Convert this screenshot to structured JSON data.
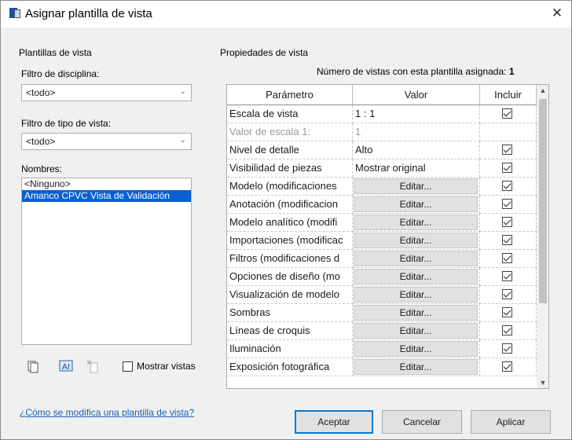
{
  "window": {
    "title": "Asignar plantilla de vista",
    "close_glyph": "✕"
  },
  "left": {
    "group_title": "Plantillas de vista",
    "discipline_filter": {
      "label": "Filtro de disciplina:",
      "value": "<todo>"
    },
    "viewtype_filter": {
      "label": "Filtro de tipo de vista:",
      "value": "<todo>"
    },
    "names_label": "Nombres:",
    "names": [
      "<Ninguno>",
      "Amanco CPVC Vista de Validación"
    ],
    "selected_index": 1,
    "show_views_label": "Mostrar vistas"
  },
  "right": {
    "group_title": "Propiedades de vista",
    "count_text": "Número de vistas con esta plantilla asignada:",
    "count_value": "1",
    "headers": {
      "param": "Parámetro",
      "value": "Valor",
      "include": "Incluir"
    },
    "rows": [
      {
        "param": "Escala de vista",
        "value": "1 : 1",
        "kind": "text",
        "include": true
      },
      {
        "param": "Valor de escala    1:",
        "value": "1",
        "kind": "gray",
        "include": null
      },
      {
        "param": "Nivel de detalle",
        "value": "Alto",
        "kind": "text",
        "include": true
      },
      {
        "param": "Visibilidad de piezas",
        "value": "Mostrar original",
        "kind": "text",
        "include": true
      },
      {
        "param": "Modelo (modificaciones",
        "value": "Editar...",
        "kind": "button",
        "include": true
      },
      {
        "param": "Anotación (modificacion",
        "value": "Editar...",
        "kind": "button",
        "include": true
      },
      {
        "param": "Modelo analítico (modifi",
        "value": "Editar...",
        "kind": "button",
        "include": true
      },
      {
        "param": "Importaciones (modificac",
        "value": "Editar...",
        "kind": "button",
        "include": true
      },
      {
        "param": "Filtros (modificaciones d",
        "value": "Editar...",
        "kind": "button",
        "include": true
      },
      {
        "param": "Opciones de diseño (mo",
        "value": "Editar...",
        "kind": "button",
        "include": true
      },
      {
        "param": "Visualización de modelo",
        "value": "Editar...",
        "kind": "button",
        "include": true
      },
      {
        "param": "Sombras",
        "value": "Editar...",
        "kind": "button",
        "include": true
      },
      {
        "param": "Líneas de croquis",
        "value": "Editar...",
        "kind": "button",
        "include": true
      },
      {
        "param": "Iluminación",
        "value": "Editar...",
        "kind": "button",
        "include": true
      },
      {
        "param": "Exposición fotográfica",
        "value": "Editar...",
        "kind": "button",
        "include": true
      }
    ]
  },
  "footer": {
    "help_link": "¿Cómo se modifica una plantilla de vista?",
    "ok": "Aceptar",
    "cancel": "Cancelar",
    "apply": "Aplicar"
  }
}
